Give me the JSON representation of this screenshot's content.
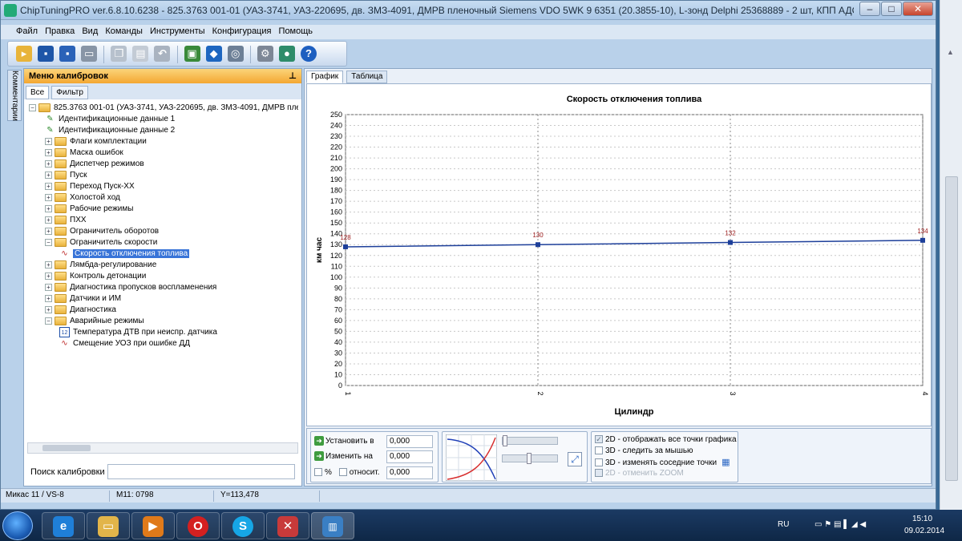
{
  "window": {
    "title": "ChipTuningPRO ver.6.8.10.6238 - 825.3763 001-01 (УАЗ-3741, УАЗ-220695, дв. ЗМЗ-4091, ДМРВ пленочный Siemens VDO 5WK 9 6351 (20.3855-10), L-зонд Delphi 25368889 - 2 шт, КПП АДС, гл. пара 4.625 без электров..."
  },
  "menu": [
    "Файл",
    "Правка",
    "Вид",
    "Команды",
    "Инструменты",
    "Конфигурация",
    "Помощь"
  ],
  "sidetab": {
    "label": "Комментарии"
  },
  "leftpanel": {
    "title": "Меню калибровок",
    "tabs": [
      "Все",
      "Фильтр"
    ],
    "search_label": "Поиск калибровки",
    "search_value": ""
  },
  "tree": [
    {
      "label": "825.3763 001-01 (УАЗ-3741, УАЗ-220695, дв. ЗМЗ-4091, ДМРВ плен",
      "level": 0,
      "type": "root"
    },
    {
      "label": "Идентификационные данные 1",
      "level": 1,
      "type": "doc"
    },
    {
      "label": "Идентификационные данные 2",
      "level": 1,
      "type": "doc"
    },
    {
      "label": "Флаги комплектации",
      "level": 1,
      "type": "folder"
    },
    {
      "label": "Маска ошибок",
      "level": 1,
      "type": "folder"
    },
    {
      "label": "Диспетчер режимов",
      "level": 1,
      "type": "folder"
    },
    {
      "label": "Пуск",
      "level": 1,
      "type": "folder"
    },
    {
      "label": "Переход Пуск-ХХ",
      "level": 1,
      "type": "folder"
    },
    {
      "label": "Холостой ход",
      "level": 1,
      "type": "folder"
    },
    {
      "label": "Рабочие режимы",
      "level": 1,
      "type": "folder"
    },
    {
      "label": "ПХХ",
      "level": 1,
      "type": "folder"
    },
    {
      "label": "Ограничитель оборотов",
      "level": 1,
      "type": "folder"
    },
    {
      "label": "Ограничитель скорости",
      "level": 1,
      "type": "folder-open"
    },
    {
      "label": "Скорость отключения топлива",
      "level": 2,
      "type": "graph",
      "selected": true
    },
    {
      "label": "Лямбда-регулирование",
      "level": 1,
      "type": "folder"
    },
    {
      "label": "Контроль детонации",
      "level": 1,
      "type": "folder"
    },
    {
      "label": "Диагностика пропусков воспламенения",
      "level": 1,
      "type": "folder"
    },
    {
      "label": "Датчики и ИМ",
      "level": 1,
      "type": "folder"
    },
    {
      "label": "Диагностика",
      "level": 1,
      "type": "folder"
    },
    {
      "label": "Аварийные режимы",
      "level": 1,
      "type": "folder-open"
    },
    {
      "label": "Температура ДТВ при неиспр. датчика",
      "level": 2,
      "type": "value"
    },
    {
      "label": "Смещение УОЗ при ошибке ДД",
      "level": 2,
      "type": "graph"
    }
  ],
  "righttabs": [
    "График",
    "Таблица"
  ],
  "chart_data": {
    "type": "line",
    "title": "Скорость отключения топлива",
    "xlabel": "Цилиндр",
    "ylabel": "км час",
    "x": [
      1,
      2,
      3,
      4
    ],
    "xticks": [
      "1",
      "2",
      "3",
      "4"
    ],
    "ylim": [
      0,
      250
    ],
    "ystep": 10,
    "grid": true,
    "series": [
      {
        "values": [
          128,
          130,
          132,
          134
        ],
        "labels": [
          "128",
          "130",
          "132",
          "134"
        ],
        "color": "#1d3f9a"
      }
    ]
  },
  "controls": {
    "set_label": "Установить в",
    "change_label": "Изменить на",
    "set_value": "0,000",
    "change_value": "0,000",
    "pct_label": "%",
    "rel_label": "относит.",
    "rel_value": "0,000",
    "opt1": "2D - отображать все точки графика",
    "opt2": "3D - следить за мышью",
    "opt3": "3D - изменять соседние точки",
    "opt4": "2D - отменить ZOOM"
  },
  "status": {
    "cell1": "Микас 11 / VS-8",
    "cell2": "M11: 0798",
    "cell3": "Y=113,478"
  },
  "tray": {
    "lang": "RU",
    "time": "15:10",
    "date": "09.02.2014"
  }
}
